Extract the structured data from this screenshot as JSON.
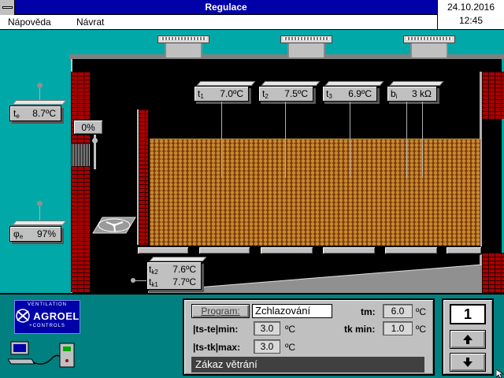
{
  "window": {
    "title": "Regulace"
  },
  "clock": {
    "date": "24.10.2016",
    "time": "12:45"
  },
  "menu": {
    "items": [
      "Nápověda",
      "Návrat"
    ]
  },
  "scene": {
    "outside_temp": {
      "label": "t",
      "sub": "e",
      "value": "8.7ºC"
    },
    "outside_humidity": {
      "label": "φ",
      "sub": "e",
      "value": "97%"
    },
    "flap_opening": "0%",
    "sensors": [
      {
        "label": "t",
        "sub": "1",
        "value": "7.0ºC"
      },
      {
        "label": "t",
        "sub": "2",
        "value": "7.5ºC"
      },
      {
        "label": "t",
        "sub": "3",
        "value": "6.9ºC"
      },
      {
        "label": "b",
        "sub": "i",
        "value": "3 kΩ"
      }
    ],
    "channel_temps": [
      {
        "label": "t",
        "sub": "k2",
        "value": "7.6ºC"
      },
      {
        "label": "t",
        "sub": "k1",
        "value": "7.7ºC"
      }
    ]
  },
  "logo": {
    "top": "VENTILATION",
    "name": "AGROEL",
    "bottom": "+CONTROLS"
  },
  "panel": {
    "program_button": "Program:",
    "program_value": "Zchlazování",
    "diff_min_label": "|ts-te|min:",
    "diff_min_value": "3.0",
    "diff_max_label": "|ts-tk|max:",
    "diff_max_value": "3.0",
    "unit": "ºC",
    "tm_label": "tm:",
    "tm_value": "6.0",
    "tkmin_label": "tk min:",
    "tkmin_value": "1.0",
    "status": "Zákaz větrání"
  },
  "controls": {
    "counter": "1",
    "up_icon": "arrow-up-icon",
    "down_icon": "arrow-down-icon"
  },
  "colors": {
    "title_bar": "#0000a8",
    "background": "#00a8a8",
    "brick": "#a80000",
    "grain": "#c98a2f"
  }
}
